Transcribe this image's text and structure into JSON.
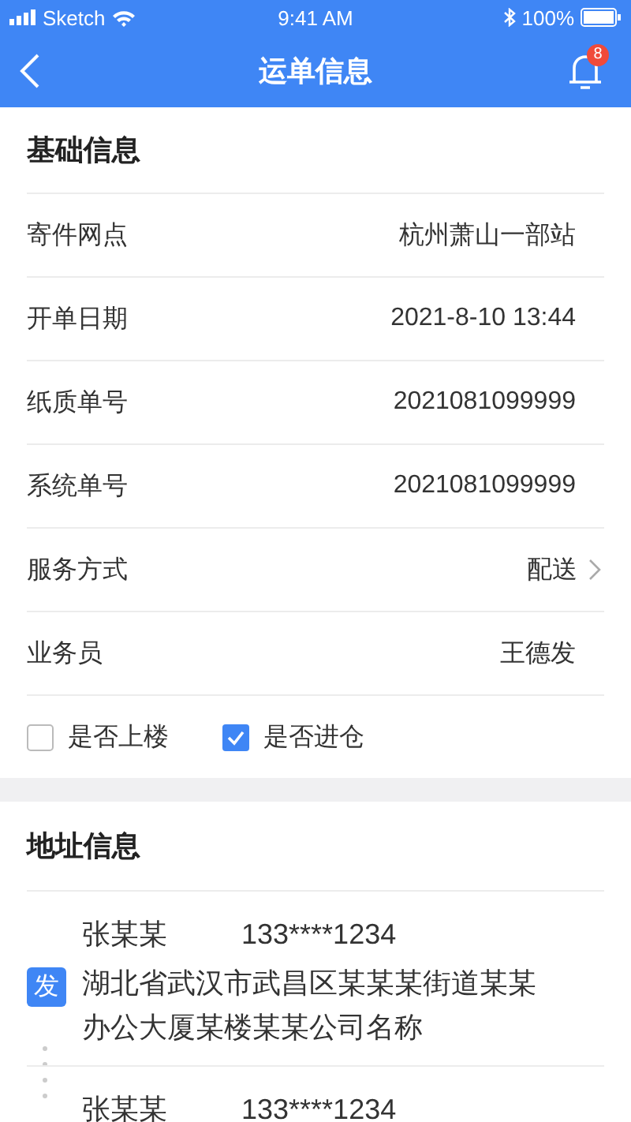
{
  "status_bar": {
    "carrier": "Sketch",
    "time": "9:41 AM",
    "battery": "100%"
  },
  "nav": {
    "title": "运单信息",
    "badge": "8"
  },
  "basic": {
    "title": "基础信息",
    "rows": [
      {
        "label": "寄件网点",
        "value": "杭州萧山一部站",
        "kind": "text"
      },
      {
        "label": "开单日期",
        "value": "2021-8-10 13:44",
        "kind": "text"
      },
      {
        "label": "纸质单号",
        "value": "2021081099999",
        "kind": "text"
      },
      {
        "label": "系统单号",
        "value": "2021081099999",
        "kind": "text"
      },
      {
        "label": "服务方式",
        "value": "配送",
        "kind": "link"
      },
      {
        "label": "业务员",
        "value": "王德发",
        "kind": "text"
      }
    ],
    "checks": [
      {
        "label": "是否上楼",
        "checked": false
      },
      {
        "label": "是否进仓",
        "checked": true
      }
    ]
  },
  "address": {
    "title": "地址信息",
    "entries": [
      {
        "tag": "发",
        "name": "张某某",
        "phone": "133****1234",
        "address": "湖北省武汉市武昌区某某某街道某某办公大厦某楼某某公司名称"
      },
      {
        "name": "张某某",
        "phone": "133****1234"
      }
    ]
  }
}
